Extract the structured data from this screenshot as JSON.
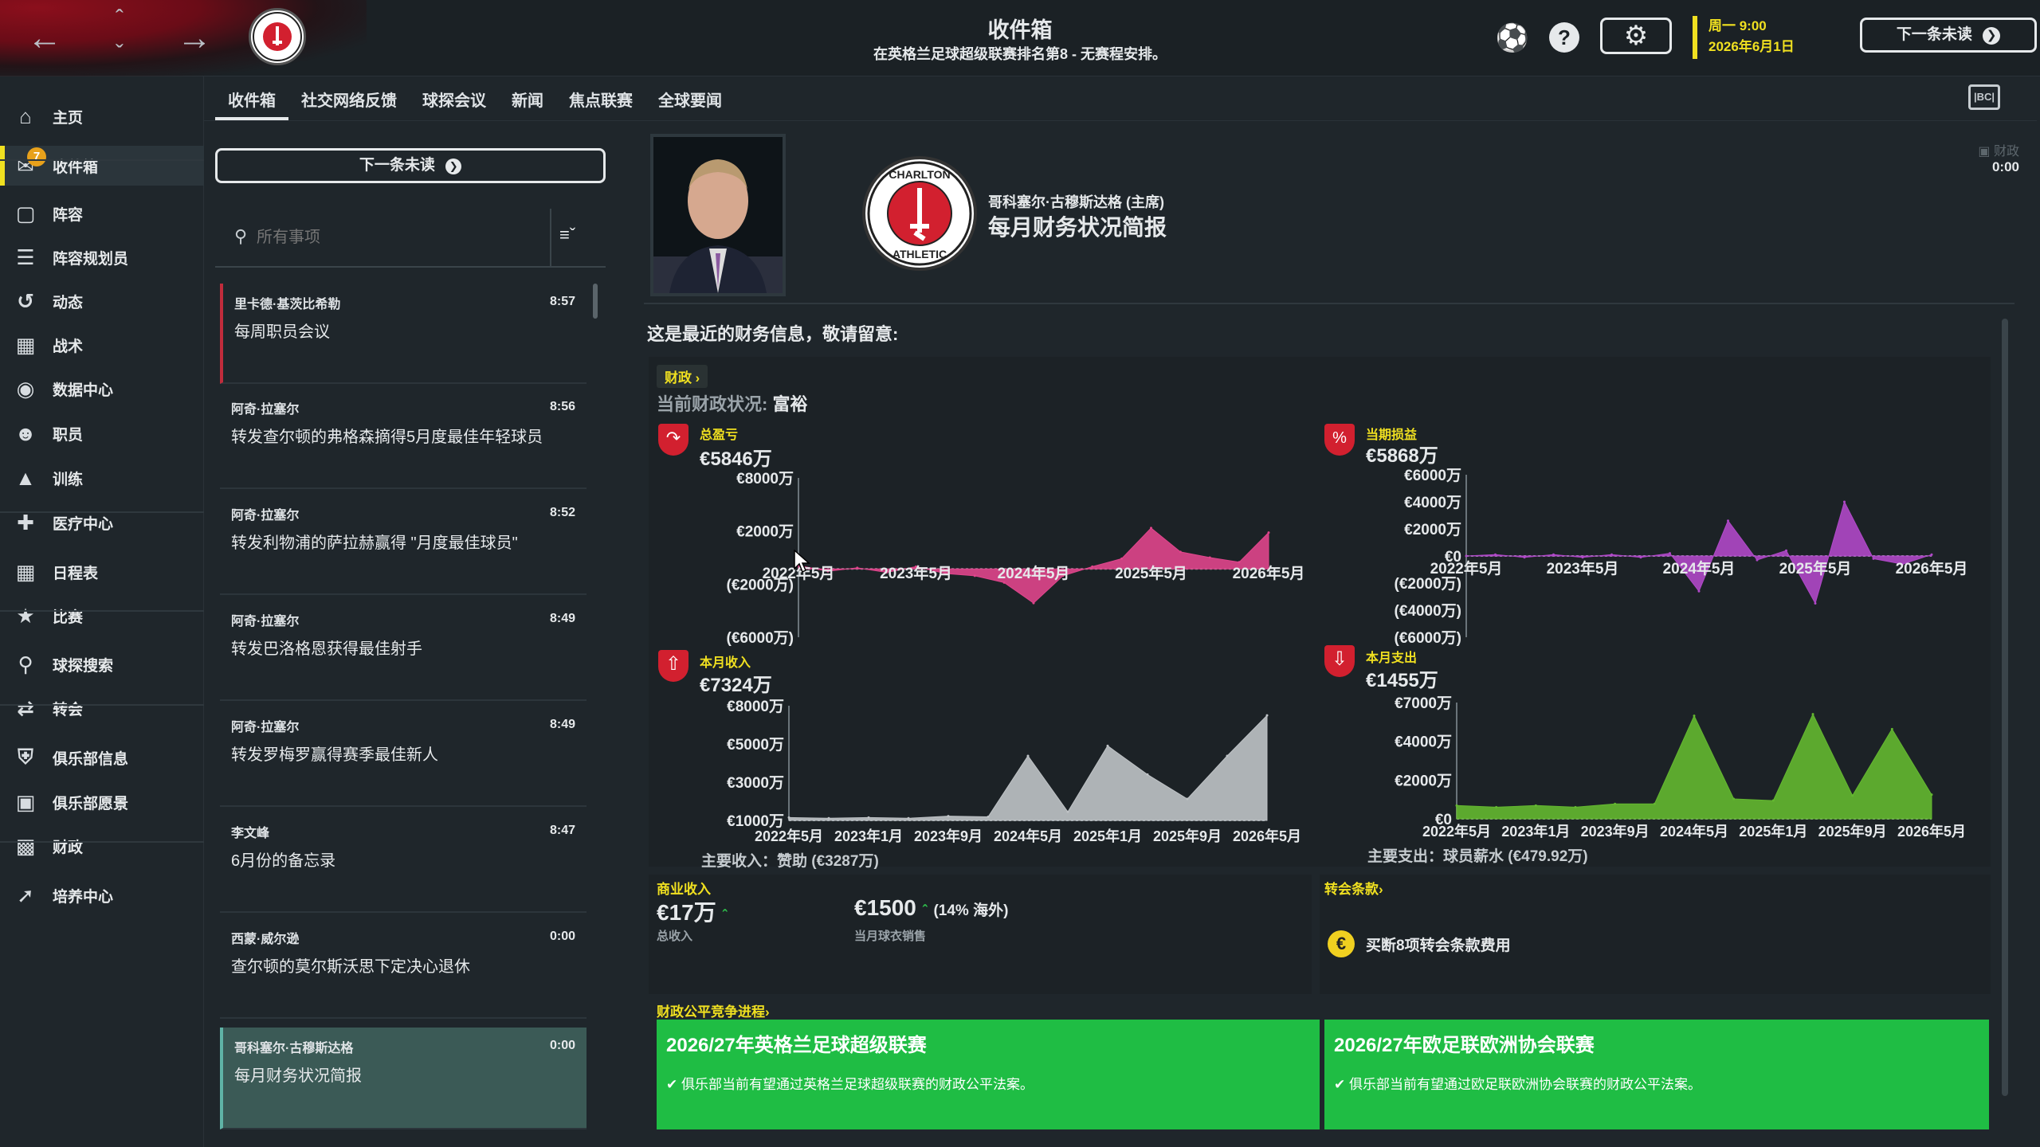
{
  "topbar": {
    "title": "收件箱",
    "subtitle": "在英格兰足球超级联赛排名第8 - 无赛程安排。",
    "date_line1": "周一 9:00",
    "date_line2": "2026年6月1日",
    "next_unread_label": "下一条未读"
  },
  "sidebar": {
    "items": [
      {
        "label": "主页",
        "icon": "home-icon"
      },
      {
        "label": "收件箱",
        "icon": "inbox-icon",
        "badge": "7"
      },
      {
        "label": "阵容",
        "icon": "shirt-icon"
      },
      {
        "label": "阵容规划员",
        "icon": "clipboard-icon"
      },
      {
        "label": "动态",
        "icon": "dynamics-icon"
      },
      {
        "label": "战术",
        "icon": "tactics-icon"
      },
      {
        "label": "数据中心",
        "icon": "data-hub-icon"
      },
      {
        "label": "职员",
        "icon": "staff-icon"
      },
      {
        "label": "训练",
        "icon": "training-icon"
      },
      {
        "label": "医疗中心",
        "icon": "medical-icon"
      },
      {
        "label": "日程表",
        "icon": "calendar-icon"
      },
      {
        "label": "比赛",
        "icon": "trophy-icon"
      },
      {
        "label": "球探搜索",
        "icon": "scouting-icon"
      },
      {
        "label": "转会",
        "icon": "transfer-icon"
      },
      {
        "label": "俱乐部信息",
        "icon": "club-info-icon"
      },
      {
        "label": "俱乐部愿景",
        "icon": "club-vision-icon"
      },
      {
        "label": "财政",
        "icon": "finances-icon"
      },
      {
        "label": "培养中心",
        "icon": "development-icon"
      }
    ]
  },
  "tabs": [
    "收件箱",
    "社交网络反馈",
    "球探会议",
    "新闻",
    "焦点联赛",
    "全球要闻"
  ],
  "inbox": {
    "next_unread_label": "下一条未读",
    "search_placeholder": "所有事项",
    "messages": [
      {
        "from": "里卡德·基茨比希勒",
        "time": "8:57",
        "subject": "每周职员会议"
      },
      {
        "from": "阿奇·拉塞尔",
        "time": "8:56",
        "subject": "转发查尔顿的弗格森摘得5月度最佳年轻球员"
      },
      {
        "from": "阿奇·拉塞尔",
        "time": "8:52",
        "subject": "转发利物浦的萨拉赫赢得 \"月度最佳球员\""
      },
      {
        "from": "阿奇·拉塞尔",
        "time": "8:49",
        "subject": "转发巴洛格恩获得最佳射手"
      },
      {
        "from": "阿奇·拉塞尔",
        "time": "8:49",
        "subject": "转发罗梅罗赢得赛季最佳新人"
      },
      {
        "from": "李文峰",
        "time": "8:47",
        "subject": "6月份的备忘录"
      },
      {
        "from": "西蒙·威尔逊",
        "time": "0:00",
        "subject": "查尔顿的莫尔斯沃思下定决心退休"
      },
      {
        "from": "哥科塞尔·古穆斯达格",
        "time": "0:00",
        "subject": "每月财务状况简报"
      }
    ]
  },
  "message": {
    "sender": "哥科塞尔·古穆斯达格 (主席)",
    "title": "每月财务状况简报",
    "club_name": "CHARLTON",
    "club_name2": "ATHLETIC",
    "corner_label": "财政",
    "corner_time": "0:00",
    "intro": "这是最近的财务信息，敬请留意:",
    "finance_link": "财政",
    "status_label": "当前财政状况:",
    "status_value": "富裕",
    "main_income": "主要收入：赞助 (€3287万)",
    "main_expense": "主要支出：球员薪水 (€479.92万)",
    "commercial_title": "商业收入",
    "total_income_value": "€17万",
    "total_income_label": "总收入",
    "shirt_value": "€1500",
    "shirt_extra": "(14% 海外)",
    "shirt_label": "当月球衣销售",
    "transfer_clauses_title": "转会条款",
    "transfer_clause_text": "买断8项转会条款费用",
    "ffp_title": "财政公平竞争进程",
    "ffp_cards": [
      {
        "title": "2026/27年英格兰足球超级联赛",
        "text": "俱乐部当前有望通过英格兰足球超级联赛的财政公平法案。"
      },
      {
        "title": "2026/27年欧足联欧洲协会联赛",
        "text": "俱乐部当前有望通过欧足联欧洲协会联赛的财政公平法案。"
      }
    ]
  },
  "colors": {
    "accent_yellow": "#f0e020",
    "profit_pink": "#e0458c",
    "period_purple": "#b048c8",
    "income_grey": "#bfc3c6",
    "expense_green": "#64b830",
    "ffp_green": "#1fbd44"
  },
  "chart_data": [
    {
      "type": "area",
      "title": "总盈亏",
      "value_label": "€5846万",
      "y_ticks": [
        "€8000万",
        "€2000万",
        "(€2000万)",
        "(€6000万)"
      ],
      "ylim": [
        -6000,
        8000
      ],
      "x_ticks": [
        "2022年5月",
        "2023年5月",
        "2024年5月",
        "2025年5月",
        "2026年5月"
      ],
      "x": [
        "2022-05",
        "2022-08",
        "2022-11",
        "2023-02",
        "2023-05",
        "2023-08",
        "2023-11",
        "2024-02",
        "2024-05",
        "2024-08",
        "2024-11",
        "2025-02",
        "2025-05",
        "2025-08",
        "2025-11",
        "2026-02",
        "2026-05"
      ],
      "values": [
        300,
        -200,
        100,
        -300,
        200,
        -400,
        -600,
        -1200,
        -3000,
        -600,
        200,
        900,
        3600,
        1500,
        1000,
        600,
        3200
      ],
      "series": [
        {
          "name": "",
          "color": "#e0458c"
        }
      ]
    },
    {
      "type": "area",
      "title": "当期损益",
      "value_label": "€5868万",
      "y_ticks": [
        "€6000万",
        "€4000万",
        "€2000万",
        "€0",
        "(€2000万)",
        "(€4000万)",
        "(€6000万)"
      ],
      "ylim": [
        -6000,
        6000
      ],
      "x_ticks": [
        "2022年5月",
        "2023年5月",
        "2024年5月",
        "2025年5月",
        "2026年5月"
      ],
      "x": [
        "2022-05",
        "2022-08",
        "2022-11",
        "2023-02",
        "2023-05",
        "2023-08",
        "2023-11",
        "2024-02",
        "2024-05",
        "2024-08",
        "2024-11",
        "2025-02",
        "2025-05",
        "2025-08",
        "2025-11",
        "2026-02",
        "2026-05"
      ],
      "values": [
        0,
        100,
        -100,
        100,
        -100,
        100,
        -100,
        200,
        -2600,
        2600,
        -300,
        400,
        -3500,
        4000,
        -200,
        -600,
        100
      ],
      "series": [
        {
          "name": "",
          "color": "#b048c8"
        }
      ]
    },
    {
      "type": "area",
      "title": "本月收入",
      "value_label": "€7324万",
      "y_ticks": [
        "€8000万",
        "€5000万",
        "€3000万",
        "€1000万"
      ],
      "ylim": [
        0,
        8000
      ],
      "x_ticks": [
        "2022年5月",
        "2023年1月",
        "2023年9月",
        "2024年5月",
        "2025年1月",
        "2025年9月",
        "2026年5月"
      ],
      "x": [
        "2022-05",
        "2022-09",
        "2023-01",
        "2023-05",
        "2023-09",
        "2024-01",
        "2024-05",
        "2024-09",
        "2025-01",
        "2025-05",
        "2025-09",
        "2026-01",
        "2026-05"
      ],
      "values": [
        200,
        150,
        200,
        150,
        300,
        250,
        4500,
        600,
        5200,
        3200,
        1500,
        4500,
        7324
      ],
      "series": [
        {
          "name": "",
          "color": "#bfc3c6"
        }
      ]
    },
    {
      "type": "area",
      "title": "本月支出",
      "value_label": "€1455万",
      "y_ticks": [
        "€7000万",
        "€4000万",
        "€2000万",
        "€0"
      ],
      "ylim": [
        0,
        7000
      ],
      "x_ticks": [
        "2022年5月",
        "2023年1月",
        "2023年9月",
        "2024年5月",
        "2025年1月",
        "2025年9月",
        "2026年5月"
      ],
      "x": [
        "2022-05",
        "2022-09",
        "2023-01",
        "2023-05",
        "2023-09",
        "2024-01",
        "2024-05",
        "2024-09",
        "2025-01",
        "2025-05",
        "2025-09",
        "2026-01",
        "2026-05"
      ],
      "values": [
        800,
        700,
        800,
        700,
        900,
        900,
        6200,
        1200,
        1100,
        6300,
        1400,
        5400,
        1455
      ],
      "series": [
        {
          "name": "",
          "color": "#64b830"
        }
      ]
    }
  ]
}
